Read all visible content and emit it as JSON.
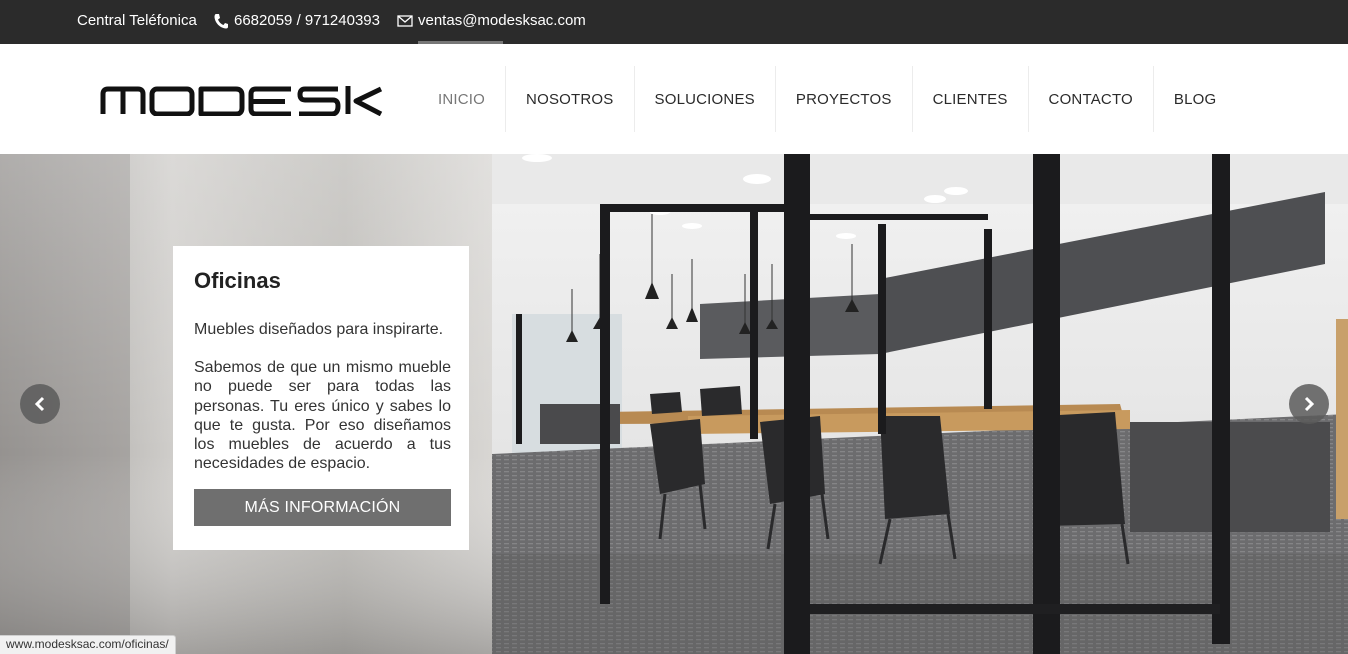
{
  "topbar": {
    "central_label": "Central Teléfonica",
    "phone_icon": "phone-icon",
    "phones": "6682059 / 971240393",
    "mail_icon": "mail-icon",
    "email": "ventas@modesksac.com"
  },
  "header": {
    "logo_text": "MODESK",
    "nav": [
      {
        "label": "INICIO",
        "active": true
      },
      {
        "label": "NOSOTROS"
      },
      {
        "label": "SOLUCIONES"
      },
      {
        "label": "PROYECTOS"
      },
      {
        "label": "CLIENTES"
      },
      {
        "label": "CONTACTO"
      },
      {
        "label": "BLOG"
      }
    ]
  },
  "slide": {
    "title": "Oficinas",
    "subtitle": "Muebles diseñados para inspirarte.",
    "text": "Sabemos de que un mismo mueble no puede ser para todas las personas. Tu eres único y sabes lo que te gusta. Por eso diseñamos los muebles de acuerdo a tus necesidades de espacio.",
    "button": "MÁS INFORMACIÓN",
    "prev_icon": "chevron-left-icon",
    "next_icon": "chevron-right-icon"
  },
  "status_url": "www.modesksac.com/oficinas/",
  "colors": {
    "topbar_bg": "#2b2b2b",
    "button_bg": "#6f6f6f",
    "active_nav": "#777777"
  }
}
